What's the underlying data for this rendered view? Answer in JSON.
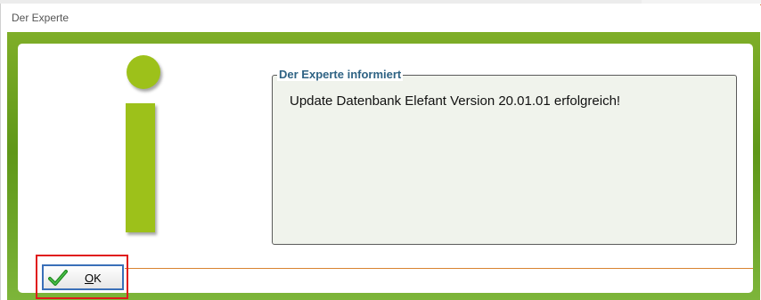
{
  "window": {
    "title": "Der Experte"
  },
  "dialog": {
    "icon": "info-i-icon",
    "group_title": "Der Experte informiert",
    "message": "Update Datenbank Elefant Version 20.01.01 erfolgreich!"
  },
  "ok_button": {
    "label_first": "O",
    "label_rest": "K",
    "icon": "checkmark-icon"
  },
  "colors": {
    "brand_green": "#9dc11a",
    "group_title": "#2f6384",
    "separator": "#d8832f",
    "highlight": "#e01a1a"
  }
}
